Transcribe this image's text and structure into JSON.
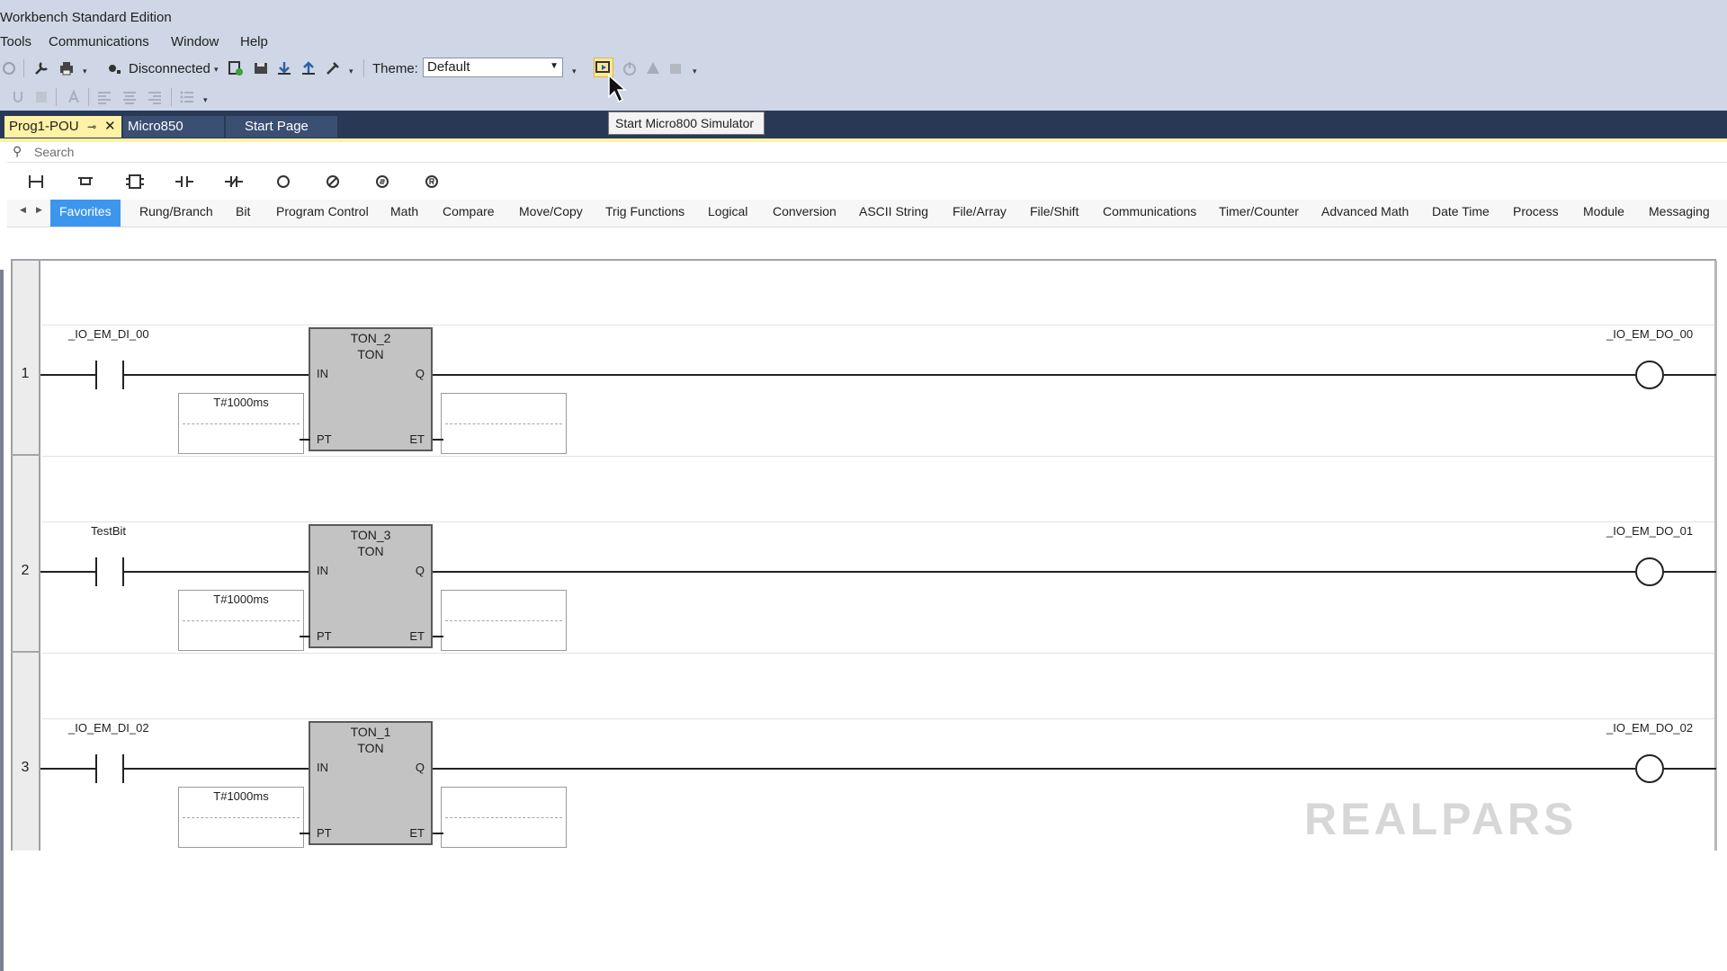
{
  "window": {
    "title": "Workbench Standard Edition"
  },
  "menu": [
    "Tools",
    "Communications",
    "Window",
    "Help"
  ],
  "toolbar": {
    "connection_status": "Disconnected",
    "theme_label": "Theme:",
    "theme_value": "Default",
    "icons": [
      "back-icon",
      "wrench-icon",
      "printer-icon",
      "connection-icon",
      "verify-icon",
      "save-icon",
      "download-icon",
      "upload-icon",
      "tool-icon",
      "simulator-icon",
      "power-icon",
      "warning-icon",
      "program-icon"
    ]
  },
  "tooltip": {
    "text": "Start Micro800 Simulator"
  },
  "doc_tabs": [
    {
      "label": "Prog1-POU",
      "active": true
    },
    {
      "label": "Micro850",
      "active": false
    },
    {
      "label": "Start Page",
      "active": false
    }
  ],
  "search": {
    "placeholder": "Search"
  },
  "instruction_icons": [
    "rung-icon",
    "branch-icon",
    "block-icon",
    "contact-icon",
    "negated-contact-icon",
    "coil-icon",
    "negated-coil-icon",
    "set-coil-icon",
    "reset-coil-icon"
  ],
  "categories": [
    "Favorites",
    "Rung/Branch",
    "Bit",
    "Program Control",
    "Math",
    "Compare",
    "Move/Copy",
    "Trig Functions",
    "Logical",
    "Conversion",
    "ASCII String",
    "File/Array",
    "File/Shift",
    "Communications",
    "Timer/Counter",
    "Advanced Math",
    "Date Time",
    "Process",
    "Module",
    "Messaging"
  ],
  "active_category": "Favorites",
  "rungs": [
    {
      "number": "1",
      "contact": "_IO_EM_DI_00",
      "block_instance": "TON_2",
      "block_type": "TON",
      "pt_value": "T#1000ms",
      "coil": "_IO_EM_DO_00"
    },
    {
      "number": "2",
      "contact": "TestBit",
      "block_instance": "TON_3",
      "block_type": "TON",
      "pt_value": "T#1000ms",
      "coil": "_IO_EM_DO_01"
    },
    {
      "number": "3",
      "contact": "_IO_EM_DI_02",
      "block_instance": "TON_1",
      "block_type": "TON",
      "pt_value": "T#1000ms",
      "coil": "_IO_EM_DO_02"
    }
  ],
  "pin_labels": {
    "in": "IN",
    "q": "Q",
    "pt": "PT",
    "et": "ET"
  },
  "watermark": "REALPARS"
}
